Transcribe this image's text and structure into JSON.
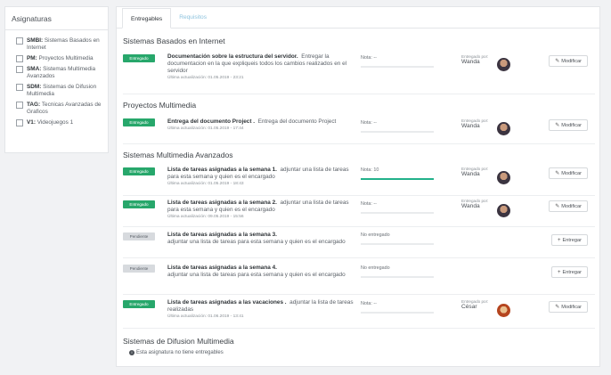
{
  "sidebar": {
    "title": "Asignaturas",
    "items": [
      {
        "code": "SMBI:",
        "name": " Sistemas Basados en Internet"
      },
      {
        "code": "PM:",
        "name": " Proyectos Multimedia"
      },
      {
        "code": "SMA:",
        "name": " Sistemas Multimedia Avanzados"
      },
      {
        "code": "SDM:",
        "name": " Sistemas de Difusion Multimedia"
      },
      {
        "code": "TAG:",
        "name": " Tecnicas Avanzadas de Graficos"
      },
      {
        "code": "V1:",
        "name": " Videojuegos 1"
      }
    ]
  },
  "tabs": {
    "entregables": "Entregables",
    "requisitos": "Requisitos"
  },
  "sections": {
    "smbi": "Sistemas Basados en Internet",
    "pm": "Proyectos Multimedia",
    "sma": "Sistemas Multimedia Avanzados",
    "sdm": "Sistemas de Difusion Multimedia"
  },
  "labels": {
    "delivered_by": "Entregado por:",
    "modify": "Modificar",
    "deliver": "Entregar",
    "no_deliverables": "Esta asignatura no tiene entregables"
  },
  "rows": [
    {
      "status": "Entregado",
      "title": "Documentación sobre la estructura del servidor.",
      "desc": "Entregar la documentacion en la que expliqueis todos los cambios realizados en el servidor",
      "updated": "Última actualización: 01.05.2019 - 23:21",
      "grade": "Nota: --",
      "grade_value": 0,
      "by": "Wanda"
    },
    {
      "status": "Entregado",
      "title": "Entrega del documento Project .",
      "desc": "Entrega del documento Project",
      "updated": "Última actualización: 01.05.2019 - 17:44",
      "grade": "Nota: --",
      "grade_value": 0,
      "by": "Wanda"
    },
    {
      "status": "Entregado",
      "title": "Lista de tareas asignadas a la semana 1.",
      "desc": "adjuntar una lista de tareas para esta semana y quien es el encargado",
      "updated": "Última actualización: 01.05.2019 - 18:43",
      "grade": "Nota: 10",
      "grade_value": 1.0,
      "by": "Wanda"
    },
    {
      "status": "Entregado",
      "title": "Lista de tareas asignadas a la semana 2.",
      "desc": "adjuntar una lista de tareas para esta semana y quien es el encargado",
      "updated": "Última actualización: 09.05.2019 - 15:56",
      "grade": "Nota: --",
      "grade_value": 0,
      "by": "Wanda"
    },
    {
      "status": "Pendiente",
      "title": "Lista de tareas asignadas a la semana 3.",
      "desc": "adjuntar una lista de tareas para esta semana y quien es el encargado",
      "grade": "No entregado",
      "grade_value": 0
    },
    {
      "status": "Pendiente",
      "title": "Lista de tareas asignadas a la semana 4.",
      "desc": "adjuntar una lista de tareas para esta semana y quien es el encargado",
      "grade": "No entregado",
      "grade_value": 0
    },
    {
      "status": "Entregado",
      "title": "Lista de tareas asignadas a las vacaciones .",
      "desc": "adjuntar la lista de tareas realizadas",
      "updated": "Última actualización: 01.06.2019 - 13:41",
      "grade": "Nota: --",
      "grade_value": 0,
      "by": "César"
    }
  ]
}
